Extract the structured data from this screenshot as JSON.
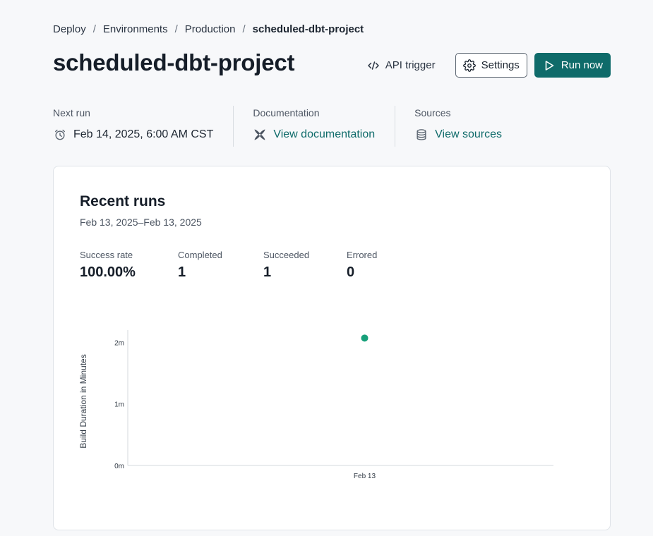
{
  "breadcrumb": {
    "items": [
      "Deploy",
      "Environments",
      "Production"
    ],
    "current": "scheduled-dbt-project",
    "separator": "/"
  },
  "page_title": "scheduled-dbt-project",
  "actions": {
    "api_trigger": "API trigger",
    "settings": "Settings",
    "run_now": "Run now"
  },
  "meta": {
    "next_run": {
      "label": "Next run",
      "value": "Feb 14, 2025, 6:00 AM CST",
      "icon": "alarm-clock-icon"
    },
    "documentation": {
      "label": "Documentation",
      "value": "View documentation",
      "icon": "dbt-logo-icon"
    },
    "sources": {
      "label": "Sources",
      "value": "View sources",
      "icon": "database-icon"
    }
  },
  "recent_runs": {
    "title": "Recent runs",
    "date_range": "Feb 13, 2025–Feb 13, 2025",
    "stats": [
      {
        "label": "Success rate",
        "value": "100.00%"
      },
      {
        "label": "Completed",
        "value": "1"
      },
      {
        "label": "Succeeded",
        "value": "1"
      },
      {
        "label": "Errored",
        "value": "0"
      }
    ]
  },
  "colors": {
    "accent": "#0f6b6a",
    "success_point": "#17a07a"
  },
  "chart_data": {
    "type": "scatter",
    "title": "",
    "xlabel": "",
    "ylabel": "Build Duration in Minutes",
    "x_categories": [
      "Feb 13"
    ],
    "y_ticks": [
      "0m",
      "1m",
      "2m"
    ],
    "ylim": [
      0,
      2.2
    ],
    "grid": false,
    "series": [
      {
        "points": [
          {
            "x": "Feb 13",
            "y": 2.07
          }
        ],
        "status": "success"
      }
    ]
  }
}
